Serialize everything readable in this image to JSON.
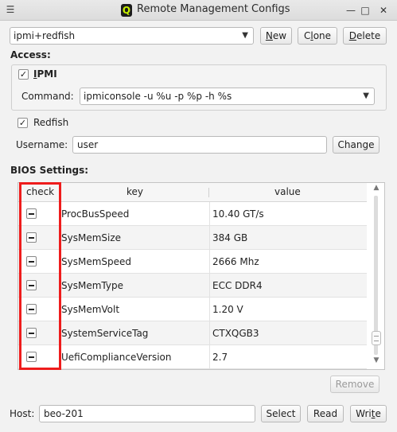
{
  "window": {
    "menu_glyph": "☰",
    "logo_letter": "Q",
    "title": "Remote Management Configs",
    "minimize_glyph": "—",
    "maximize_glyph": "□",
    "close_glyph": "✕"
  },
  "config": {
    "selected": "ipmi+redfish",
    "new_prefix": "",
    "new_ul": "N",
    "new_rest": "ew",
    "clone_prefix": "C",
    "clone_ul": "l",
    "clone_rest": "one",
    "delete_prefix": "",
    "delete_ul": "D",
    "delete_rest": "elete"
  },
  "access": {
    "label": "Access:",
    "ipmi_ul": "I",
    "ipmi_rest": "PMI",
    "ipmi_checked": true,
    "command_label": "Command:",
    "command_value": "ipmiconsole -u %u -p %p -h %s",
    "redfish_label": "Redfish",
    "redfish_checked": true,
    "username_label": "Username:",
    "username_value": "user",
    "change_label": "Change"
  },
  "bios": {
    "label": "BIOS Settings:",
    "columns": [
      "check",
      "key",
      "value"
    ],
    "rows": [
      {
        "key": "ProcBusSpeed",
        "value": "10.40 GT/s"
      },
      {
        "key": "SysMemSize",
        "value": "384 GB"
      },
      {
        "key": "SysMemSpeed",
        "value": "2666 Mhz"
      },
      {
        "key": "SysMemType",
        "value": "ECC DDR4"
      },
      {
        "key": "SysMemVolt",
        "value": "1.20 V"
      },
      {
        "key": "SystemServiceTag",
        "value": "CTXQGB3"
      },
      {
        "key": "UefiComplianceVersion",
        "value": "2.7"
      }
    ],
    "remove_label": "Remove",
    "highlight_color": "#ee1c1c"
  },
  "host": {
    "label": "Host:",
    "value": "beo-201",
    "select_label": "Select",
    "read_label": "Read",
    "write_prefix": "Wri",
    "write_ul": "t",
    "write_rest": "e"
  }
}
